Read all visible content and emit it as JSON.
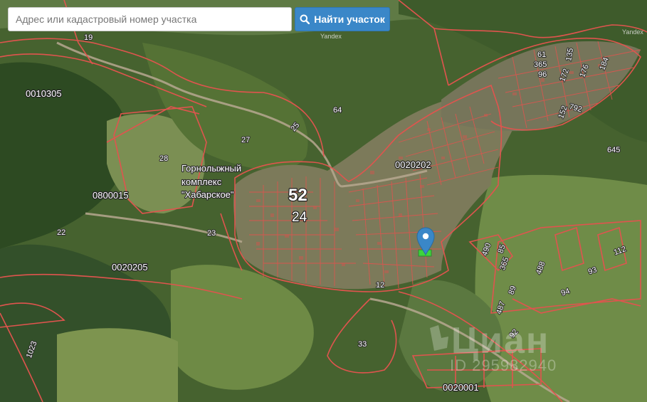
{
  "search": {
    "placeholder": "Адрес или кадастровый номер участка",
    "value": ""
  },
  "find_button": {
    "label": "Найти участок",
    "icon": "search-icon"
  },
  "provider": "Yandex",
  "district_labels": {
    "a": "0010305",
    "b": "0800015",
    "c": "0020205",
    "d": "0020202",
    "e": "0020001"
  },
  "poi": {
    "line1": "Горнолыжный",
    "line2": "комплекс",
    "line3": "\"Хабарское\""
  },
  "quarter": {
    "main": "52",
    "sub": "24"
  },
  "plot_numbers": {
    "p19": "19",
    "p25": "25",
    "p64": "64",
    "p27": "27",
    "p28": "28",
    "p22": "22",
    "p23": "23",
    "p12": "12",
    "p33": "33",
    "p1023": "1023",
    "p645": "645",
    "p61": "61",
    "p365": "365",
    "p96": "96",
    "p135": "135",
    "p172": "172",
    "p176": "176",
    "p184": "184",
    "p152": "152",
    "p792": "792",
    "p490": "490",
    "p85": "85",
    "p365b": "365",
    "p488": "488",
    "p89": "89",
    "p487": "487",
    "p94": "94",
    "p93": "93",
    "p112": "112",
    "p92": "92"
  },
  "watermark": {
    "brand": "Циан",
    "id": "ID 295982940"
  },
  "marker": {
    "icon": "map-pin-icon",
    "color": "#3a87c8"
  },
  "colors": {
    "boundary": "#e0544e",
    "button": "#3a87c8"
  }
}
